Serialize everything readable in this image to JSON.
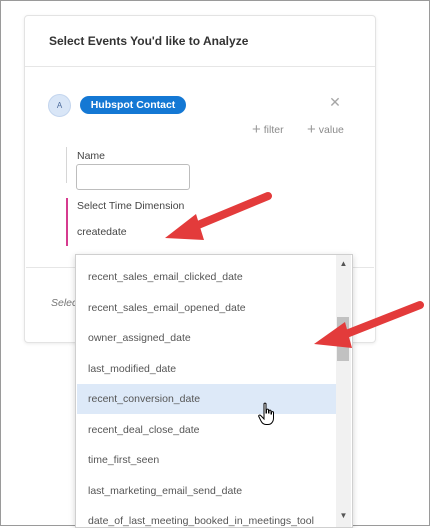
{
  "card": {
    "title": "Select Events You'd like to Analyze",
    "avatar_letter": "A",
    "event_name": "Hubspot Contact",
    "close_icon": "close-icon",
    "add_filter_label": "filter",
    "add_value_label": "value",
    "name_label": "Name",
    "name_value": "",
    "time_dimension_label": "Select Time Dimension",
    "time_dimension_value": "createdate",
    "partial_text": "Select"
  },
  "dropdown": {
    "options": [
      "recent_sales_email_clicked_date",
      "recent_sales_email_opened_date",
      "owner_assigned_date",
      "last_modified_date",
      "recent_conversion_date",
      "recent_deal_close_date",
      "time_first_seen",
      "last_marketing_email_send_date",
      "date_of_last_meeting_booked_in_meetings_tool"
    ],
    "highlighted": "recent_conversion_date"
  },
  "annotations": {
    "arrow_color": "#e33b3b"
  },
  "colors": {
    "accent": "#1478d4",
    "highlight": "#dde9f8",
    "pink_bar": "#d63b8f"
  }
}
